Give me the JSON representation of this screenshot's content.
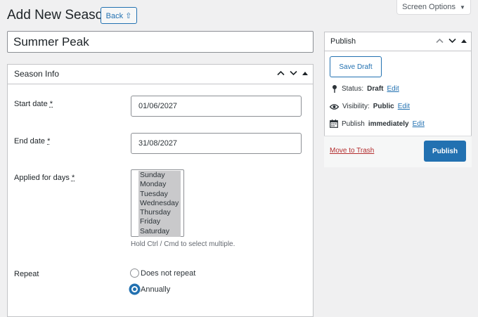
{
  "header": {
    "title": "Add New Season",
    "back_label": "Back ⇧",
    "screen_options": "Screen Options",
    "screen_options_arrow": "▼"
  },
  "post_title": {
    "value": "Summer Peak"
  },
  "season_box": {
    "title": "Season Info",
    "start_label": "Start date",
    "start_value": "01/06/2027",
    "end_label": "End date",
    "end_value": "31/08/2027",
    "days_label": "Applied for days",
    "required_mark": "*",
    "days": [
      "Sunday",
      "Monday",
      "Tuesday",
      "Wednesday",
      "Thursday",
      "Friday",
      "Saturday"
    ],
    "days_hint": "Hold Ctrl / Cmd to select multiple.",
    "repeat_label": "Repeat",
    "repeat_options": [
      "Does not repeat",
      "Annually"
    ],
    "repeat_selected": "Annually"
  },
  "publish_box": {
    "title": "Publish",
    "save_draft": "Save Draft",
    "status_label": "Status:",
    "status_value": "Draft",
    "visibility_label": "Visibility:",
    "visibility_value": "Public",
    "publish_label": "Publish",
    "publish_value": "immediately",
    "edit": "Edit",
    "trash": "Move to Trash",
    "publish_button": "Publish"
  },
  "colors": {
    "accent": "#2271b1",
    "danger": "#b32d2e",
    "background": "#f0f0f1"
  }
}
